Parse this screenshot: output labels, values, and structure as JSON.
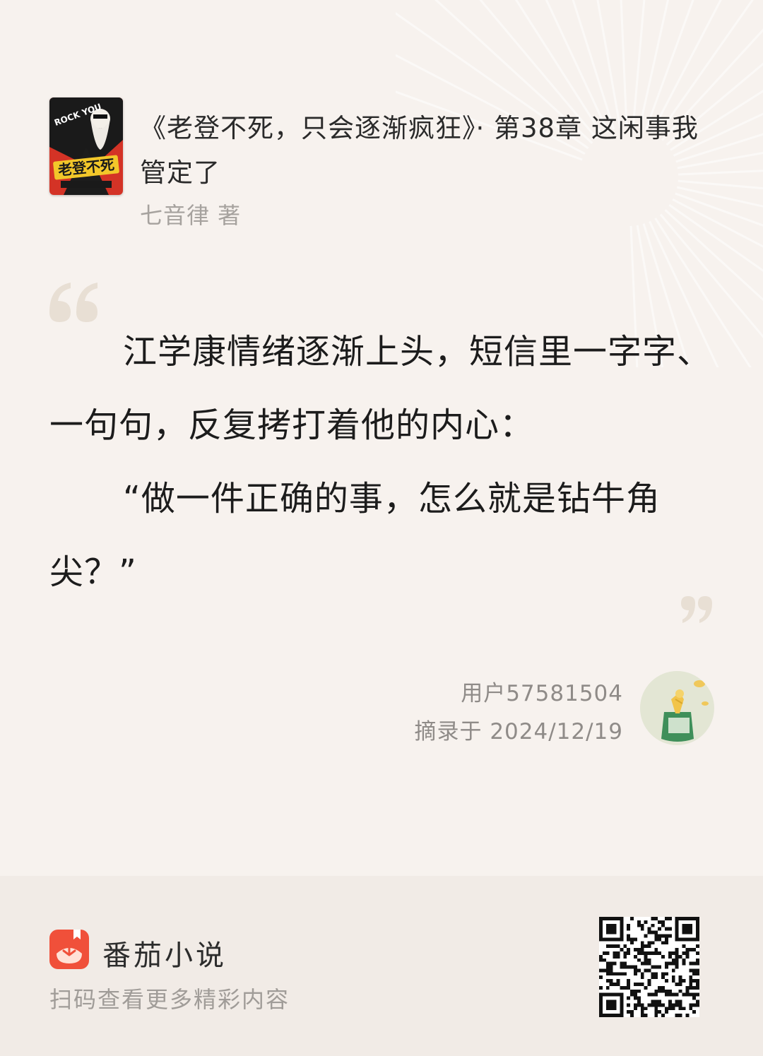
{
  "book": {
    "title": "《老登不死，只会逐渐疯狂》· 第38章 这闲事我管定了",
    "author": "七音律 著",
    "cover_text": "老登不死",
    "cover_tag": "ROCK YOU"
  },
  "excerpt": {
    "paragraphs": [
      "江学康情绪逐渐上头，短信里一字字、一句句，反复拷打着他的内心：",
      "“做一件正确的事，怎么就是钻牛角尖？”"
    ]
  },
  "user": {
    "name": "用户57581504",
    "date_label": "摘录于 2024/12/19"
  },
  "footer": {
    "app_name": "番茄小说",
    "tagline": "扫码查看更多精彩内容"
  },
  "colors": {
    "background": "#f7f2ee",
    "footer_background": "#f1ebe6",
    "quote_mark": "#e8dfd4",
    "logo_red": "#f0503a"
  },
  "icons": {
    "open_quote": "open-quote-icon",
    "close_quote": "close-quote-icon",
    "app_logo": "tomato-logo-icon",
    "avatar": "money-bag-avatar",
    "qr": "qr-code"
  }
}
